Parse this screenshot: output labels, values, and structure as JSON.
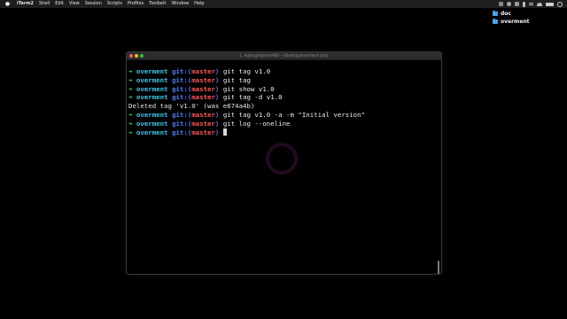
{
  "menubar": {
    "items": [
      "iTerm2",
      "Shell",
      "Edit",
      "View",
      "Session",
      "Scripts",
      "Profiles",
      "Toolbelt",
      "Window",
      "Help"
    ],
    "status_icons": [
      "sq-icon",
      "circle-icon",
      "grid-icon",
      "bluetooth-icon",
      "list-icon",
      "wifi-icon",
      "battery-icon",
      "search-icon"
    ]
  },
  "desktop": {
    "folders": [
      "doc",
      "overment"
    ]
  },
  "window": {
    "title": "1. Adam@Adams-MBP: ~/Desktop/overment (zsh)"
  },
  "terminal": {
    "prompt": {
      "arrow": "➜",
      "dir": "overment",
      "git_open": "git:(",
      "branch": "master",
      "git_close": ")"
    },
    "commands": [
      "git tag v1.0",
      "git tag",
      "git show v1.0",
      "git tag -d v1.0"
    ],
    "output": "Deleted tag 'v1.0' (was e674a4b)",
    "commands_after": [
      "git tag v1.0 -a -m \"Initial version\"",
      "git log --oneline"
    ]
  },
  "colors": {
    "arrow": "#2ed573",
    "dir": "#38c9e8",
    "git": "#4d7cf2",
    "branch": "#ff5555"
  }
}
